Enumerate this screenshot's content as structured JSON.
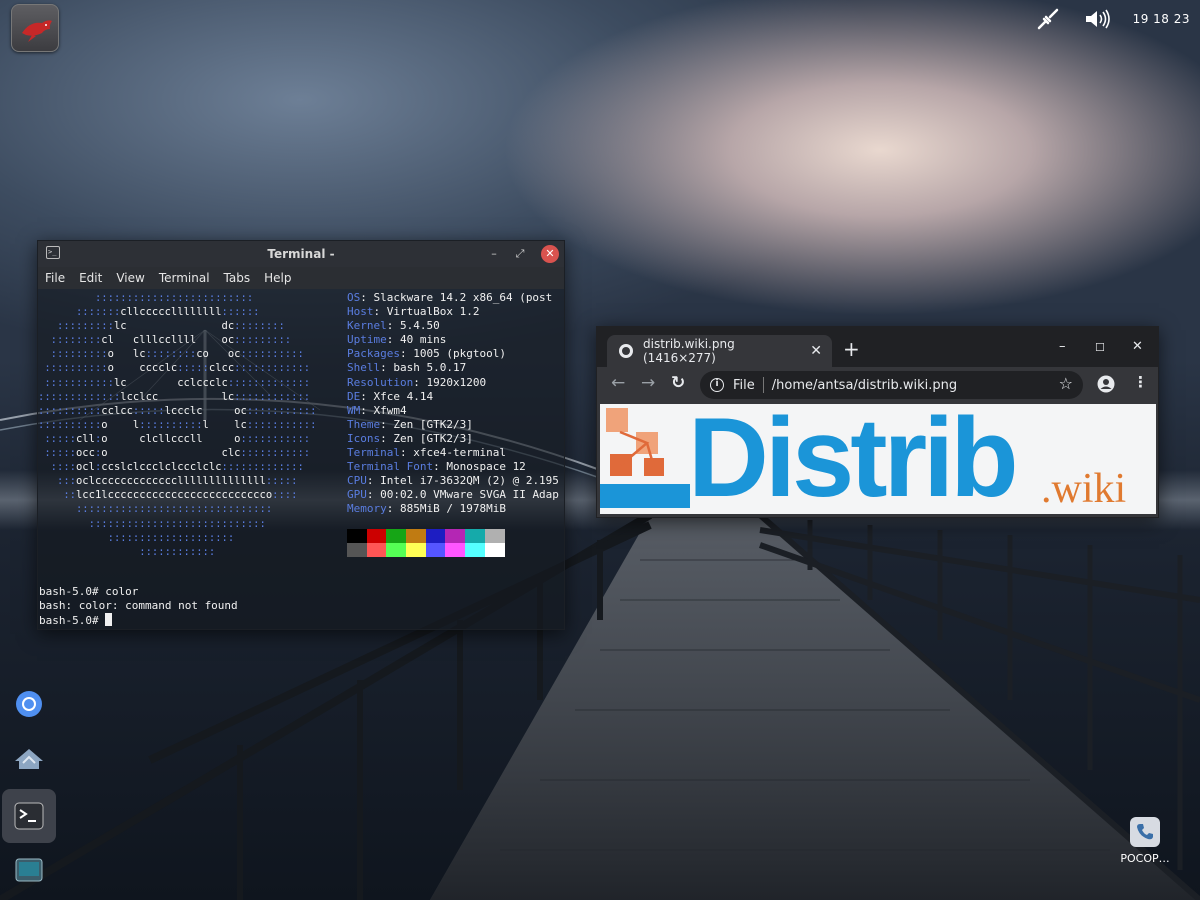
{
  "panel": {
    "clock": "19 18 23",
    "icons": [
      "network-icon",
      "volume-icon"
    ]
  },
  "dock": {
    "items": [
      "chromium-icon",
      "network-share-icon",
      "terminal-icon",
      "screen-icon"
    ]
  },
  "terminal": {
    "title": "Terminal -",
    "menu": [
      "File",
      "Edit",
      "View",
      "Terminal",
      "Tabs",
      "Help"
    ],
    "neofetch": [
      {
        "key": "OS",
        "value": ": Slackware 14.2 x86_64 (post"
      },
      {
        "key": "Host",
        "value": ": VirtualBox 1.2"
      },
      {
        "key": "Kernel",
        "value": ": 5.4.50"
      },
      {
        "key": "Uptime",
        "value": ": 40 mins"
      },
      {
        "key": "Packages",
        "value": ": 1005 (pkgtool)"
      },
      {
        "key": "Shell",
        "value": ": bash 5.0.17"
      },
      {
        "key": "Resolution",
        "value": ": 1920x1200"
      },
      {
        "key": "DE",
        "value": ": Xfce 4.14"
      },
      {
        "key": "WM",
        "value": ": Xfwm4"
      },
      {
        "key": "Theme",
        "value": ": Zen [GTK2/3]"
      },
      {
        "key": "Icons",
        "value": ": Zen [GTK2/3]"
      },
      {
        "key": "Terminal",
        "value": ": xfce4-terminal"
      },
      {
        "key": "Terminal Font",
        "value": ": Monospace 12"
      },
      {
        "key": "CPU",
        "value": ": Intel i7-3632QM (2) @ 2.195"
      },
      {
        "key": "GPU",
        "value": ": 00:02.0 VMware SVGA II Adap"
      },
      {
        "key": "Memory",
        "value": ": 885MiB / 1978MiB"
      }
    ],
    "palette_top": [
      "#000000",
      "#cc0000",
      "#16a516",
      "#c07b12",
      "#1d1dc2",
      "#b426b4",
      "#15aaaa",
      "#b0b0b0"
    ],
    "palette_bottom": [
      "#555555",
      "#ff5555",
      "#55ff55",
      "#ffff55",
      "#5555ff",
      "#ff55ff",
      "#55ffff",
      "#ffffff"
    ],
    "ascii": [
      "         :::::::::::::::::::::::::",
      "      :::::::cllcccccllllllll::::::",
      "   :::::::::lc               dc::::::::",
      "  ::::::::cl   clllccllll    oc:::::::::",
      "  :::::::::o   lc::::::::co   oc::::::::::",
      " ::::::::::o    cccclc:::::clcc::::::::::::",
      " :::::::::::lc        cclccclc:::::::::::::",
      ":::::::::::::lcclcc          lc::::::::::::",
      "::::::::::cclcc:::::lccclc     oc:::::::::::",
      "::::::::::o    l::::::::::l    lc:::::::::::",
      " :::::cll:o     clcllcccll     o:::::::::::",
      " :::::occ:o                  clc:::::::::::",
      "  ::::ocl:ccslclccclclccclclc:::::::::::::",
      "   :::oclcccccccccccccllllllllllllll:::::",
      "    ::lcc1lccccccccccccccccccccccccco::::",
      "      :::::::::::::::::::::::::::::::",
      "        ::::::::::::::::::::::::::::",
      "           ::::::::::::::::::::",
      "                ::::::::::::"
    ],
    "commands": [
      "bash-5.0# color",
      "bash: color: command not found",
      "bash-5.0# "
    ]
  },
  "browser": {
    "tab_title": "distrib.wiki.png (1416×277)",
    "new_tab": "+",
    "scheme": "File",
    "url": "/home/antsa/distrib.wiki.png",
    "logo_main": "Distrib",
    "logo_suffix": ".wiki"
  },
  "desktop": {
    "icon_label": "POCOP…"
  }
}
